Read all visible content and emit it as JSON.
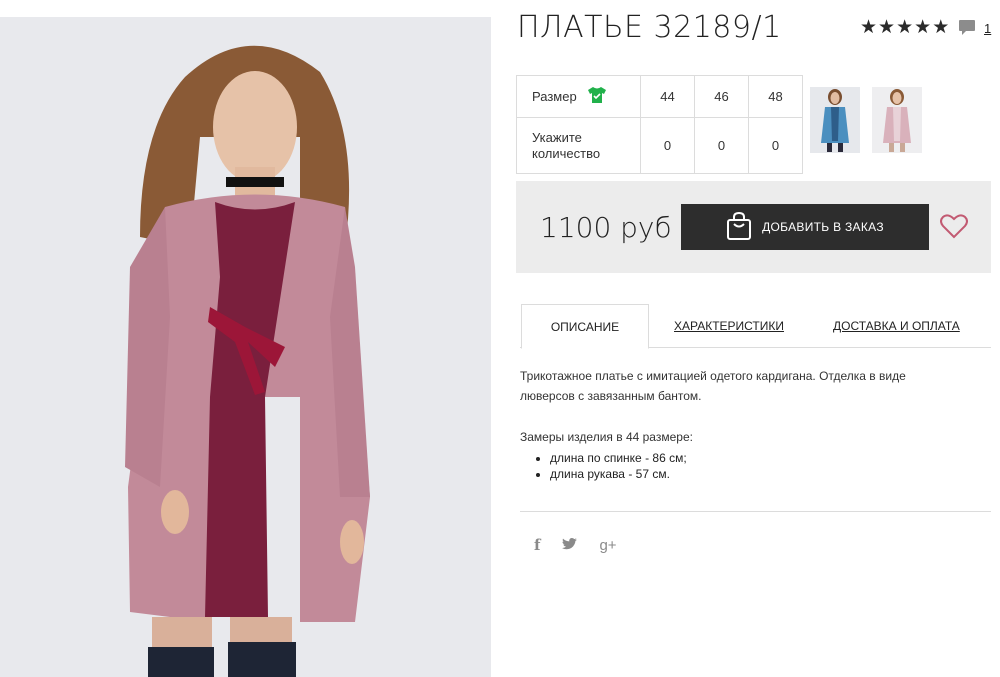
{
  "product": {
    "title": "ПЛАТЬЕ 32189/1",
    "rating": 5,
    "comments_count": "1"
  },
  "size_table": {
    "size_label": "Размер",
    "qty_label": "Укажите количество",
    "sizes": [
      "44",
      "46",
      "48"
    ],
    "quantities": [
      "0",
      "0",
      "0"
    ]
  },
  "price": {
    "value": "1100 руб",
    "add_button": "ДОБАВИТЬ В ЗАКАЗ"
  },
  "tabs": [
    {
      "label": "ОПИСАНИЕ",
      "active": true
    },
    {
      "label": "ХАРАКТЕРИСТИКИ",
      "active": false
    },
    {
      "label": "ДОСТАВКА И ОПЛАТА",
      "active": false
    }
  ],
  "description": {
    "text": "Трикотажное платье с имитацией одетого кардигана. Отделка в виде люверсов с завязанным бантом.",
    "measure_title": "Замеры изделия в 44 размере:",
    "measures": [
      "длина по спинке - 86 см;",
      "длина рукава - 57 см."
    ]
  },
  "social": {
    "facebook": "f",
    "twitter": "t",
    "googleplus": "g+"
  },
  "colors": {
    "accent_green": "#21b14b",
    "heart": "#c25a72",
    "button_bg": "#2d2d2d"
  }
}
